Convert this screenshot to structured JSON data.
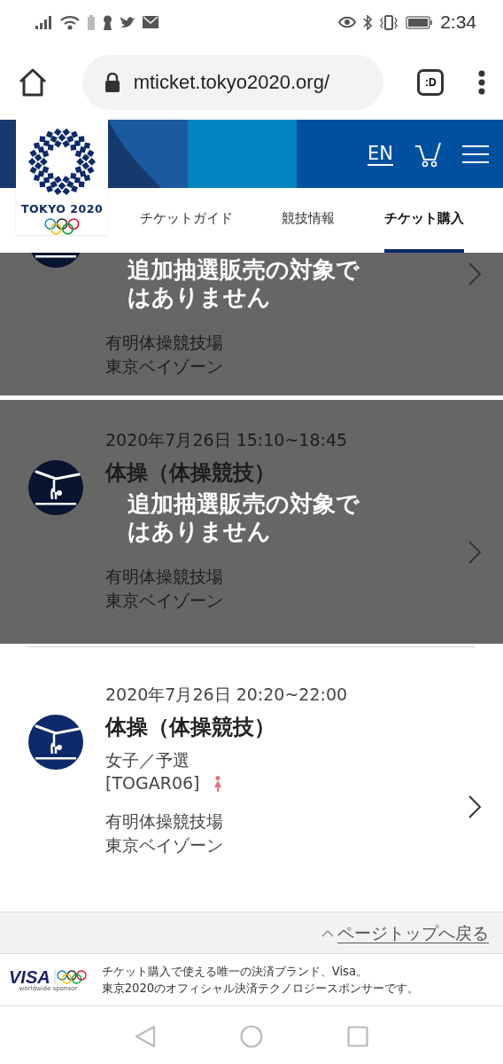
{
  "status_bar": {
    "time": "2:34"
  },
  "browser": {
    "url": "mticket.tokyo2020.org/",
    "tab_label": ":D"
  },
  "header": {
    "logo_text": "TOKYO 2020",
    "language": "EN"
  },
  "nav_tabs": [
    {
      "label": "チケットガイド",
      "selected": false
    },
    {
      "label": "競技情報",
      "selected": false
    },
    {
      "label": "チケット購入",
      "selected": true
    }
  ],
  "events": [
    {
      "clipped": true,
      "disabled": true,
      "notice": "追加抽選販売の対象ではありません",
      "venue": "有明体操競技場",
      "zone": "東京ベイゾーン"
    },
    {
      "clipped": false,
      "disabled": true,
      "date": "2020年7月26日 15:10~18:45",
      "title": "体操（体操競技）",
      "notice": "追加抽選販売の対象ではありません",
      "venue": "有明体操競技場",
      "zone": "東京ベイゾーン"
    },
    {
      "clipped": false,
      "disabled": false,
      "date": "2020年7月26日 20:20~22:00",
      "title": "体操（体操競技）",
      "category": "女子／予選",
      "code": "[TOGAR06]",
      "venue": "有明体操競技場",
      "zone": "東京ベイゾーン"
    }
  ],
  "page_top_link": "ページトップへ戻る",
  "sponsor": {
    "logo_text": "VISA",
    "tagline": "worldwide sponsor",
    "message": [
      "チケット購入で使える唯一の決済ブランド、Visa。",
      "東京2020のオフィシャル決済テクノロジースポンサーです。"
    ]
  }
}
